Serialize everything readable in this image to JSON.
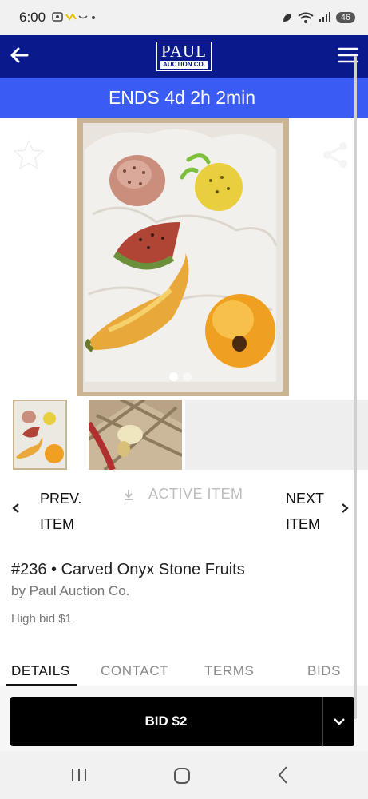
{
  "status_bar": {
    "time": "6:00",
    "left_icons": "screenshot-icon, notification-icon",
    "battery": "46"
  },
  "header": {
    "logo_top": "PAUL",
    "logo_bottom": "AUCTION CO.",
    "back_icon": "arrow-left-icon",
    "menu_icon": "hamburger-menu-icon",
    "bg_color": "#0a1a8c"
  },
  "banner": {
    "text": "ENDS 4d 2h 2min",
    "bg_color": "#3a5cf5"
  },
  "gallery": {
    "image_count": 2,
    "current_index": 1,
    "fav_icon": "star-icon",
    "share_icon": "share-icon"
  },
  "navigation": {
    "prev_line1": "PREV.",
    "prev_line2": "ITEM",
    "active_label": "ACTIVE ITEM",
    "next_line1": "NEXT",
    "next_line2": "ITEM"
  },
  "item": {
    "title": "#236 • Carved Onyx Stone Fruits",
    "seller": "by Paul Auction Co.",
    "high_bid": "High bid $1"
  },
  "tabs": [
    {
      "label": "DETAILS",
      "active": true
    },
    {
      "label": "CONTACT",
      "active": false
    },
    {
      "label": "TERMS",
      "active": false
    },
    {
      "label": "BIDS",
      "active": false
    }
  ],
  "bid": {
    "button_label": "BID $2",
    "dropdown_icon": "chevron-down-icon"
  }
}
